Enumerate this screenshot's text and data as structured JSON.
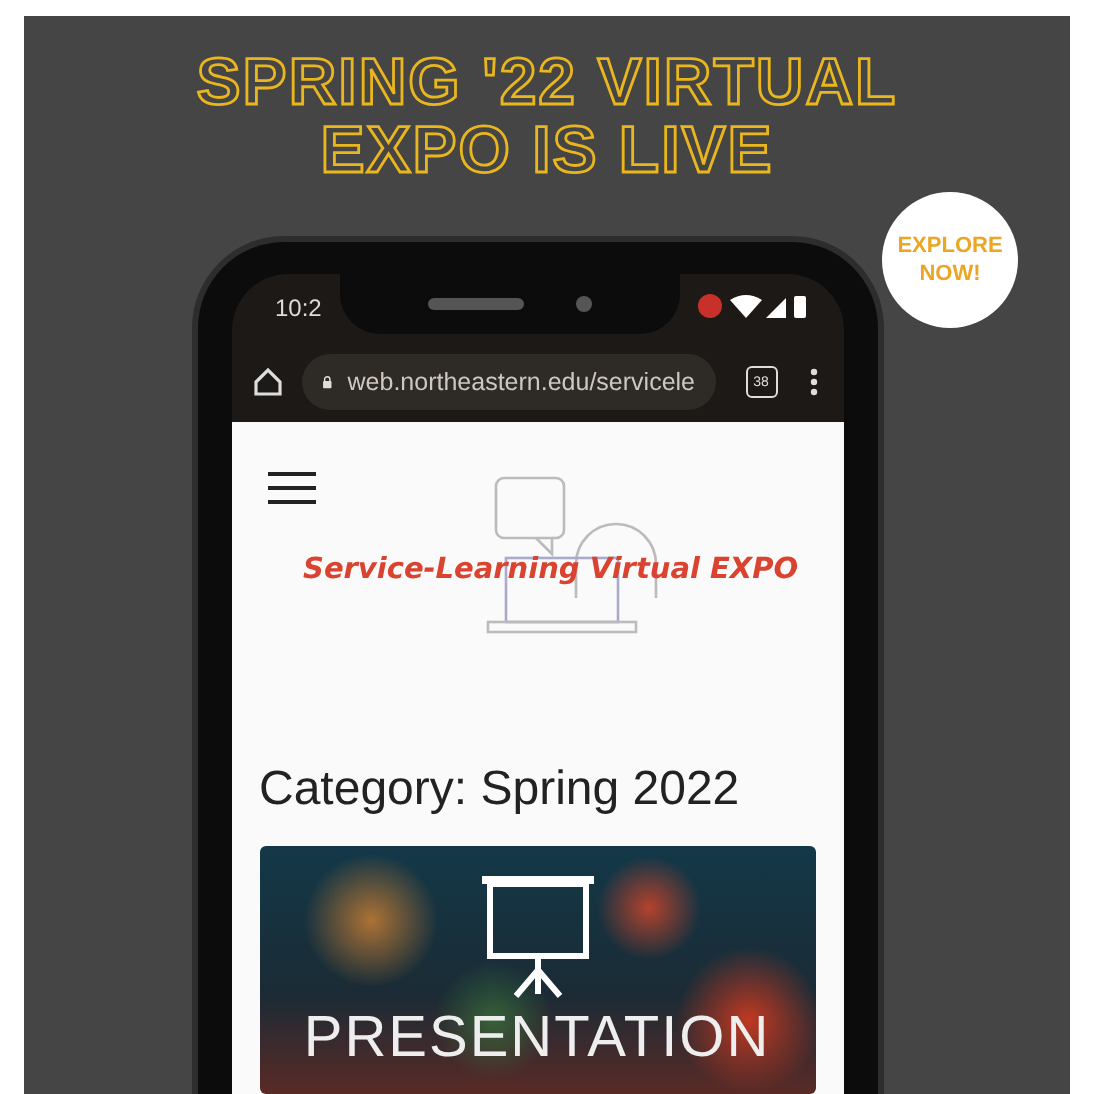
{
  "poster": {
    "headline": [
      "SPRING '22 VIRTUAL",
      "EXPO IS LIVE"
    ],
    "badge": "EXPLORE NOW!"
  },
  "status_bar": {
    "time": "10:2"
  },
  "browser": {
    "url": "web.northeastern.edu/servicele",
    "tab_count": "38"
  },
  "page": {
    "site_title": "Service-Learning Virtual EXPO",
    "heading": "Category: Spring 2022",
    "image_caption": "PRESENTATION"
  }
}
